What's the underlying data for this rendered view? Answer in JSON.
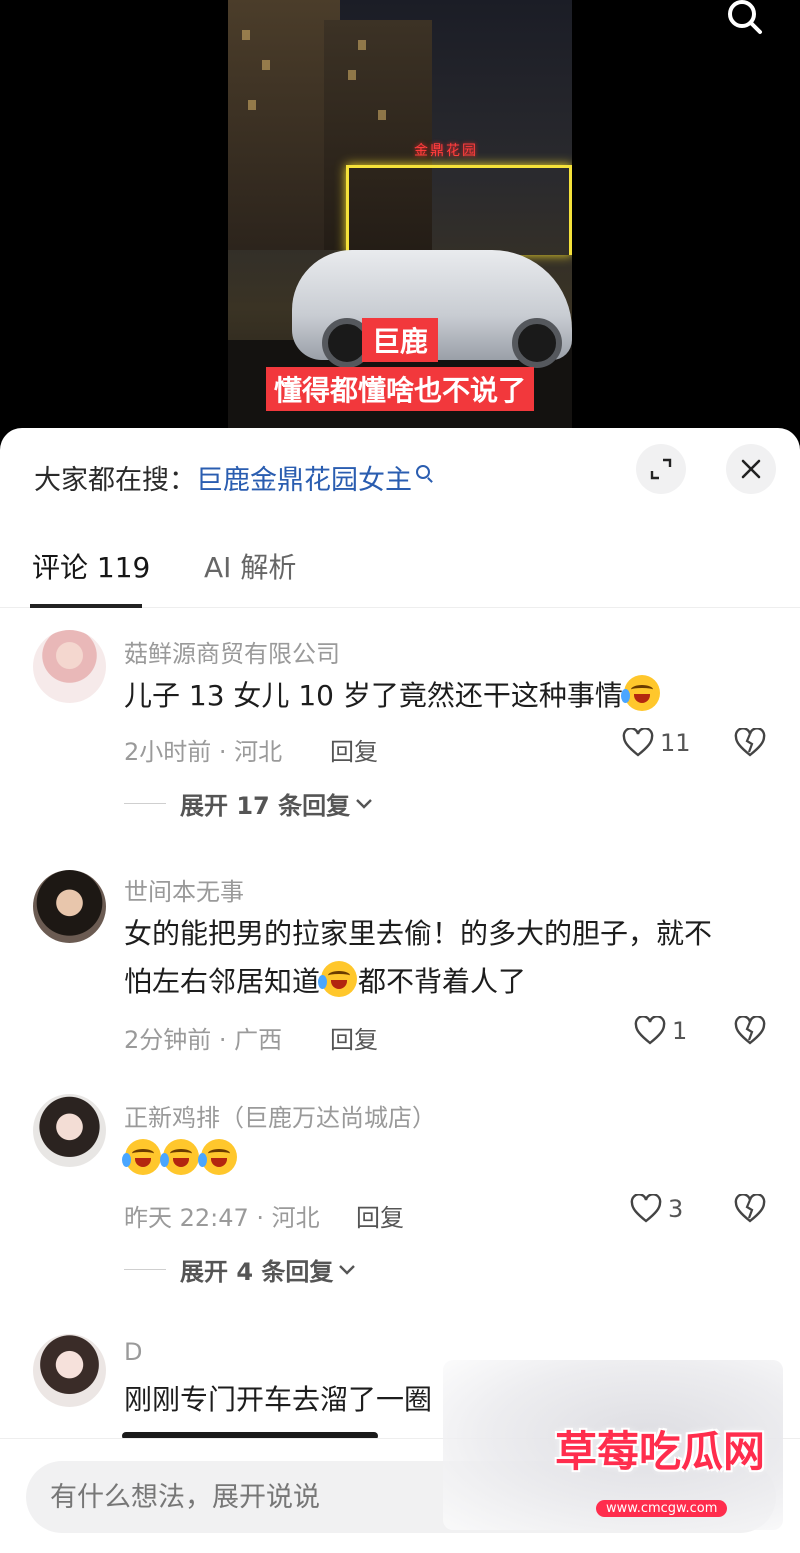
{
  "video": {
    "sign_text": "金鼎花园",
    "caption_line1": "巨鹿",
    "caption_line2": "懂得都懂啥也不说了"
  },
  "search": {
    "prefix": "大家都在搜：",
    "query": "巨鹿金鼎花园女主"
  },
  "tabs": {
    "comments": "评论 119",
    "ai": "AI 解析"
  },
  "comments": [
    {
      "username": "菇鲜源商贸有限公司",
      "text": "儿子 13 女儿 10 岁了竟然还干这种事情",
      "time_location": "2小时前 · 河北",
      "reply_label": "回复",
      "likes": "11",
      "expand_label": "展开 17 条回复"
    },
    {
      "username": "世间本无事",
      "text_line1": "女的能把男的拉家里去偷！的多大的胆子，就不",
      "text_line2a": "怕左右邻居知道",
      "text_line2b": "都不背着人了",
      "time_location": "2分钟前 · 广西",
      "reply_label": "回复",
      "likes": "1"
    },
    {
      "username": "正新鸡排（巨鹿万达尚城店）",
      "time_location": "昨天 22:47 · 河北",
      "reply_label": "回复",
      "likes": "3",
      "expand_label": "展开 4 条回复"
    },
    {
      "username": "D",
      "text": "刚刚专门开车去溜了一圈"
    }
  ],
  "input": {
    "placeholder": "有什么想法，展开说说"
  },
  "watermark": {
    "title": "草莓吃瓜网",
    "url": "www.cmcgw.com"
  },
  "colors": {
    "accent_link": "#2a5db0",
    "caption_bg": "#f2383c",
    "watermark_red": "#ff2d4d"
  }
}
